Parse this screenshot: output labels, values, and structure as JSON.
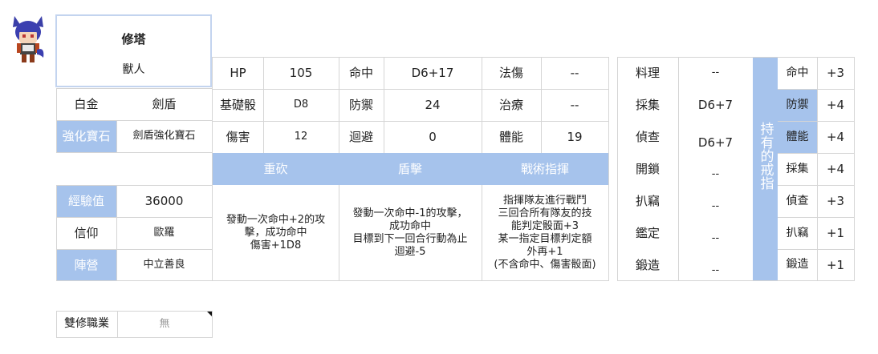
{
  "character": {
    "name": "修塔",
    "race": "獸人",
    "rank": "白金",
    "class": "劍盾",
    "gem_label": "強化寶石",
    "gem_value": "劍盾強化寶石"
  },
  "info": [
    {
      "label": "經驗值",
      "value": "36000",
      "highlight": true
    },
    {
      "label": "信仰",
      "value": "歐羅",
      "highlight": false
    },
    {
      "label": "陣營",
      "value": "中立善良",
      "highlight": true
    }
  ],
  "stats": [
    {
      "label": "HP",
      "value": "105"
    },
    {
      "label": "命中",
      "value": "D6+17"
    },
    {
      "label": "法傷",
      "value": "--"
    },
    {
      "label": "基礎骰",
      "value": "D8"
    },
    {
      "label": "防禦",
      "value": "24"
    },
    {
      "label": "治療",
      "value": "--"
    },
    {
      "label": "傷害",
      "value": "12"
    },
    {
      "label": "迴避",
      "value": "0"
    },
    {
      "label": "體能",
      "value": "19"
    }
  ],
  "skills": [
    {
      "name": "重砍",
      "desc": "發動一次命中+2的攻\n擊，成功命中\n傷害+1D8"
    },
    {
      "name": "盾擊",
      "desc": "發動一次命中-1的攻擊，\n成功命中\n目標到下一回合行動為止\n迴避-5"
    },
    {
      "name": "戰術指揮",
      "desc": "指揮隊友進行戰鬥\n三回合所有隊友的技\n能判定骰面+3\n某一指定目標判定額\n外再+1\n(不含命中、傷害骰面)"
    }
  ],
  "life_skills": [
    {
      "label": "料理",
      "value": "--"
    },
    {
      "label": "採集",
      "value": "D6+7"
    },
    {
      "label": "偵查",
      "value": "D6+7"
    },
    {
      "label": "開鎖",
      "value": "--"
    },
    {
      "label": "扒竊",
      "value": "--"
    },
    {
      "label": "鑑定",
      "value": "--"
    },
    {
      "label": "鍛造",
      "value": "--"
    }
  ],
  "rings": {
    "title": "持有的戒指",
    "items": [
      {
        "label": "命中",
        "value": "+3",
        "highlight": false
      },
      {
        "label": "防禦",
        "value": "+4",
        "highlight": true
      },
      {
        "label": "體能",
        "value": "+4",
        "highlight": true
      },
      {
        "label": "採集",
        "value": "+4",
        "highlight": false
      },
      {
        "label": "偵查",
        "value": "+3",
        "highlight": false
      },
      {
        "label": "扒竊",
        "value": "+1",
        "highlight": false
      },
      {
        "label": "鍛造",
        "value": "+1",
        "highlight": false
      }
    ]
  },
  "dual_class": {
    "label": "雙修職業",
    "value": "無"
  },
  "colors": {
    "accent": "#a6c3ec",
    "border": "#d5d5d5",
    "name_border": "#c3d4ef"
  }
}
